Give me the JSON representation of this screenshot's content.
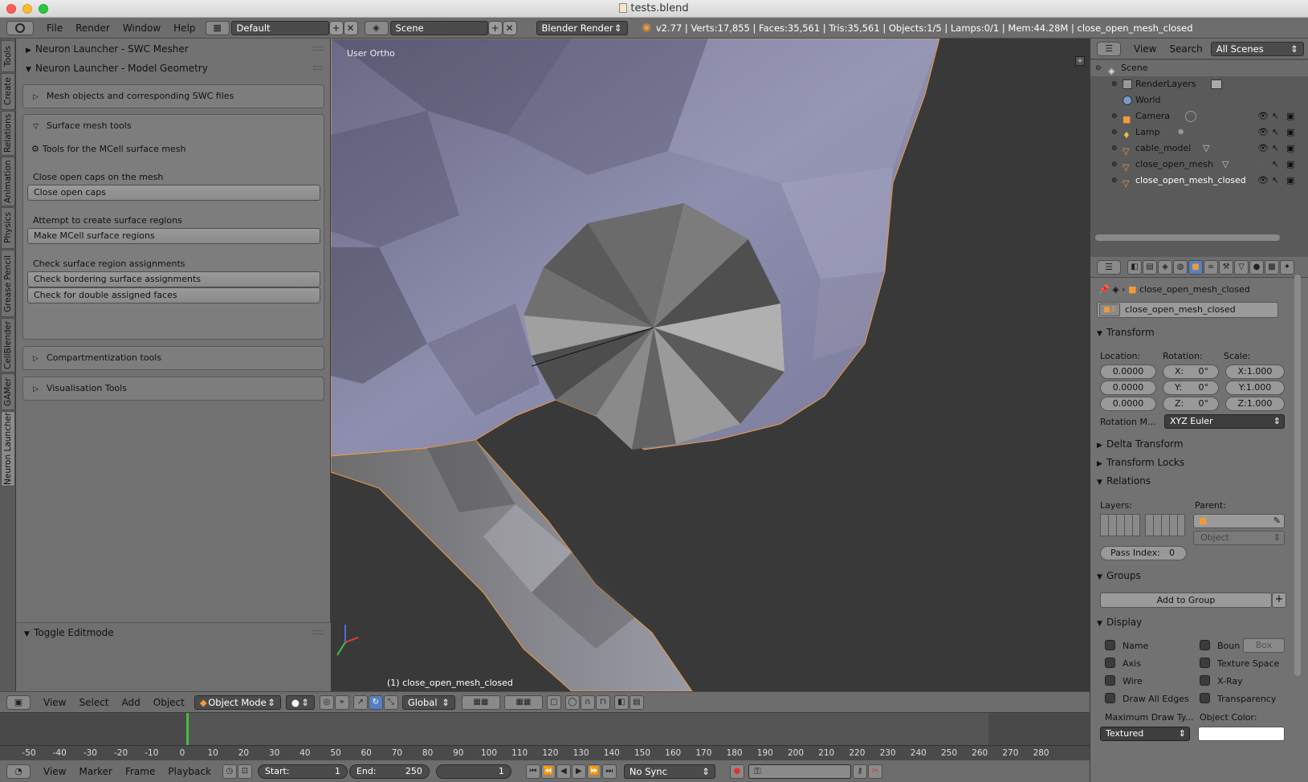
{
  "window": {
    "title": "tests.blend"
  },
  "infobar": {
    "menus": [
      "File",
      "Render",
      "Window",
      "Help"
    ],
    "screen_layout": "Default",
    "scene": "Scene",
    "render_engine": "Blender Render",
    "stats": "v2.77 | Verts:17,855 | Faces:35,561 | Tris:35,561 | Objects:1/5 | Lamps:0/1 | Mem:44.28M | close_open_mesh_closed"
  },
  "tool_tabs": [
    "Tools",
    "Create",
    "Relations",
    "Animation",
    "Physics",
    "Grease Pencil",
    "CellBlender",
    "GAMer",
    "Neuron Launcher"
  ],
  "tool_shelf": {
    "panel1": "Neuron Launcher - SWC Mesher",
    "panel2": "Neuron Launcher - Model Geometry",
    "sub_mesh": "Mesh objects and corresponding SWC files",
    "sub_surface": "Surface mesh tools",
    "surface_desc": "Tools for the MCell surface mesh",
    "close_caps_label": "Close open caps on the mesh",
    "close_caps_btn": "Close open caps",
    "regions_label": "Attempt to create surface regions",
    "regions_btn": "Make MCell surface regions",
    "check_label": "Check surface region assignments",
    "check_border_btn": "Check bordering surface assignments",
    "check_double_btn": "Check for double assigned faces",
    "sub_compart": "Compartmentization tools",
    "sub_vis": "Visualisation Tools",
    "toggle_editmode": "Toggle Editmode"
  },
  "viewport": {
    "view_label": "User Ortho",
    "object_label": "(1) close_open_mesh_closed"
  },
  "view_header": {
    "menus": [
      "View",
      "Select",
      "Add",
      "Object"
    ],
    "mode": "Object Mode",
    "orientation": "Global"
  },
  "timeline": {
    "ticks": [
      "-50",
      "-40",
      "-30",
      "-20",
      "-10",
      "0",
      "10",
      "20",
      "30",
      "40",
      "50",
      "60",
      "70",
      "80",
      "90",
      "100",
      "110",
      "120",
      "130",
      "140",
      "150",
      "160",
      "170",
      "180",
      "190",
      "200",
      "210",
      "220",
      "230",
      "240",
      "250",
      "260",
      "270",
      "280"
    ],
    "current_frame": 1
  },
  "playback": {
    "menus": [
      "View",
      "Marker",
      "Frame",
      "Playback"
    ],
    "start_label": "Start:",
    "start": "1",
    "end_label": "End:",
    "end": "250",
    "current": "1",
    "sync": "No Sync"
  },
  "outliner": {
    "menus": [
      "View",
      "Search"
    ],
    "filter": "All Scenes",
    "items": [
      "Scene",
      "RenderLayers",
      "World",
      "Camera",
      "Lamp",
      "cable_model",
      "close_open_mesh",
      "close_open_mesh_closed"
    ]
  },
  "properties": {
    "breadcrumb": "close_open_mesh_closed",
    "object_name": "close_open_mesh_closed",
    "transform": "Transform",
    "location_label": "Location:",
    "rotation_label": "Rotation:",
    "scale_label": "Scale:",
    "loc": [
      "0.0000",
      "0.0000",
      "0.0000"
    ],
    "rot": [
      "X:",
      "0°",
      "Y:",
      "0°",
      "Z:",
      "0°"
    ],
    "scale": [
      "X:1.000",
      "Y:1.000",
      "Z:1.000"
    ],
    "rotation_mode_label": "Rotation M...",
    "rotation_mode": "XYZ Euler",
    "delta": "Delta Transform",
    "locks": "Transform Locks",
    "relations": "Relations",
    "layers_label": "Layers:",
    "parent_label": "Parent:",
    "parent_type": "Object",
    "pass_index_label": "Pass Index:",
    "pass_index": "0",
    "groups": "Groups",
    "add_group": "Add to Group",
    "display": "Display",
    "name_cb": "Name",
    "bounds_cb": "Boun",
    "bounds_type": "Box",
    "axis_cb": "Axis",
    "texture_space_cb": "Texture Space",
    "wire_cb": "Wire",
    "xray_cb": "X-Ray",
    "draw_edges_cb": "Draw All Edges",
    "transparency_cb": "Transparency",
    "max_draw_label": "Maximum Draw Ty...",
    "object_color_label": "Object Color:",
    "max_draw": "Textured"
  },
  "colors": {
    "accent_orange": "#f19a3c",
    "current_frame": "#3fbf3f",
    "active_blue": "#5680c2"
  }
}
